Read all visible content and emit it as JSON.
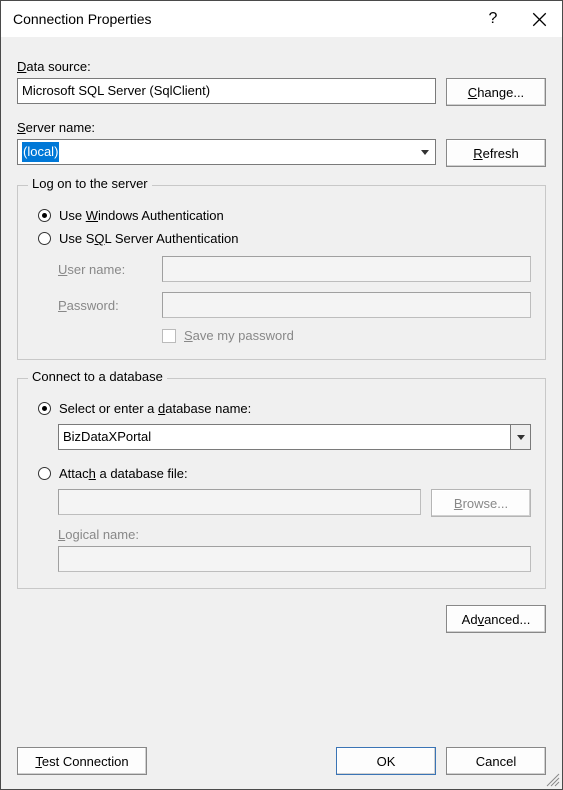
{
  "window": {
    "title": "Connection Properties",
    "help_icon": "help-icon",
    "close_icon": "close-icon"
  },
  "data_source": {
    "label_pre": "",
    "label_key": "D",
    "label_post": "ata source:",
    "value": "Microsoft SQL Server (SqlClient)"
  },
  "change_btn": {
    "pre": "",
    "key": "C",
    "post": "hange..."
  },
  "server_name": {
    "label_pre": "",
    "label_key": "S",
    "label_post": "erver name:",
    "value": "(local)"
  },
  "refresh_btn": {
    "pre": "",
    "key": "R",
    "post": "efresh"
  },
  "logon_group": {
    "title": "Log on to the server",
    "windows_auth": {
      "pre": "Use ",
      "key": "W",
      "post": "indows Authentication"
    },
    "sql_auth": {
      "pre": "Use S",
      "key": "Q",
      "post": "L Server Authentication"
    },
    "username": {
      "pre": "",
      "key": "U",
      "post": "ser name:"
    },
    "password": {
      "pre": "",
      "key": "P",
      "post": "assword:"
    },
    "save_pw": {
      "pre": "",
      "key": "S",
      "post": "ave my password"
    },
    "username_value": "",
    "password_value": ""
  },
  "db_group": {
    "title": "Connect to a database",
    "select_db": {
      "pre": "Select or enter a ",
      "key": "d",
      "post": "atabase name:"
    },
    "db_value": "BizDataXPortal",
    "attach": {
      "pre": "Attac",
      "key": "h",
      "post": " a database file:"
    },
    "attach_path": "",
    "browse": {
      "pre": "",
      "key": "B",
      "post": "rowse..."
    },
    "logical": {
      "pre": "",
      "key": "L",
      "post": "ogical name:"
    },
    "logical_value": ""
  },
  "advanced_btn": {
    "pre": "Ad",
    "key": "v",
    "post": "anced..."
  },
  "test_btn": {
    "pre": "",
    "key": "T",
    "post": "est Connection"
  },
  "ok_btn": "OK",
  "cancel_btn": "Cancel"
}
